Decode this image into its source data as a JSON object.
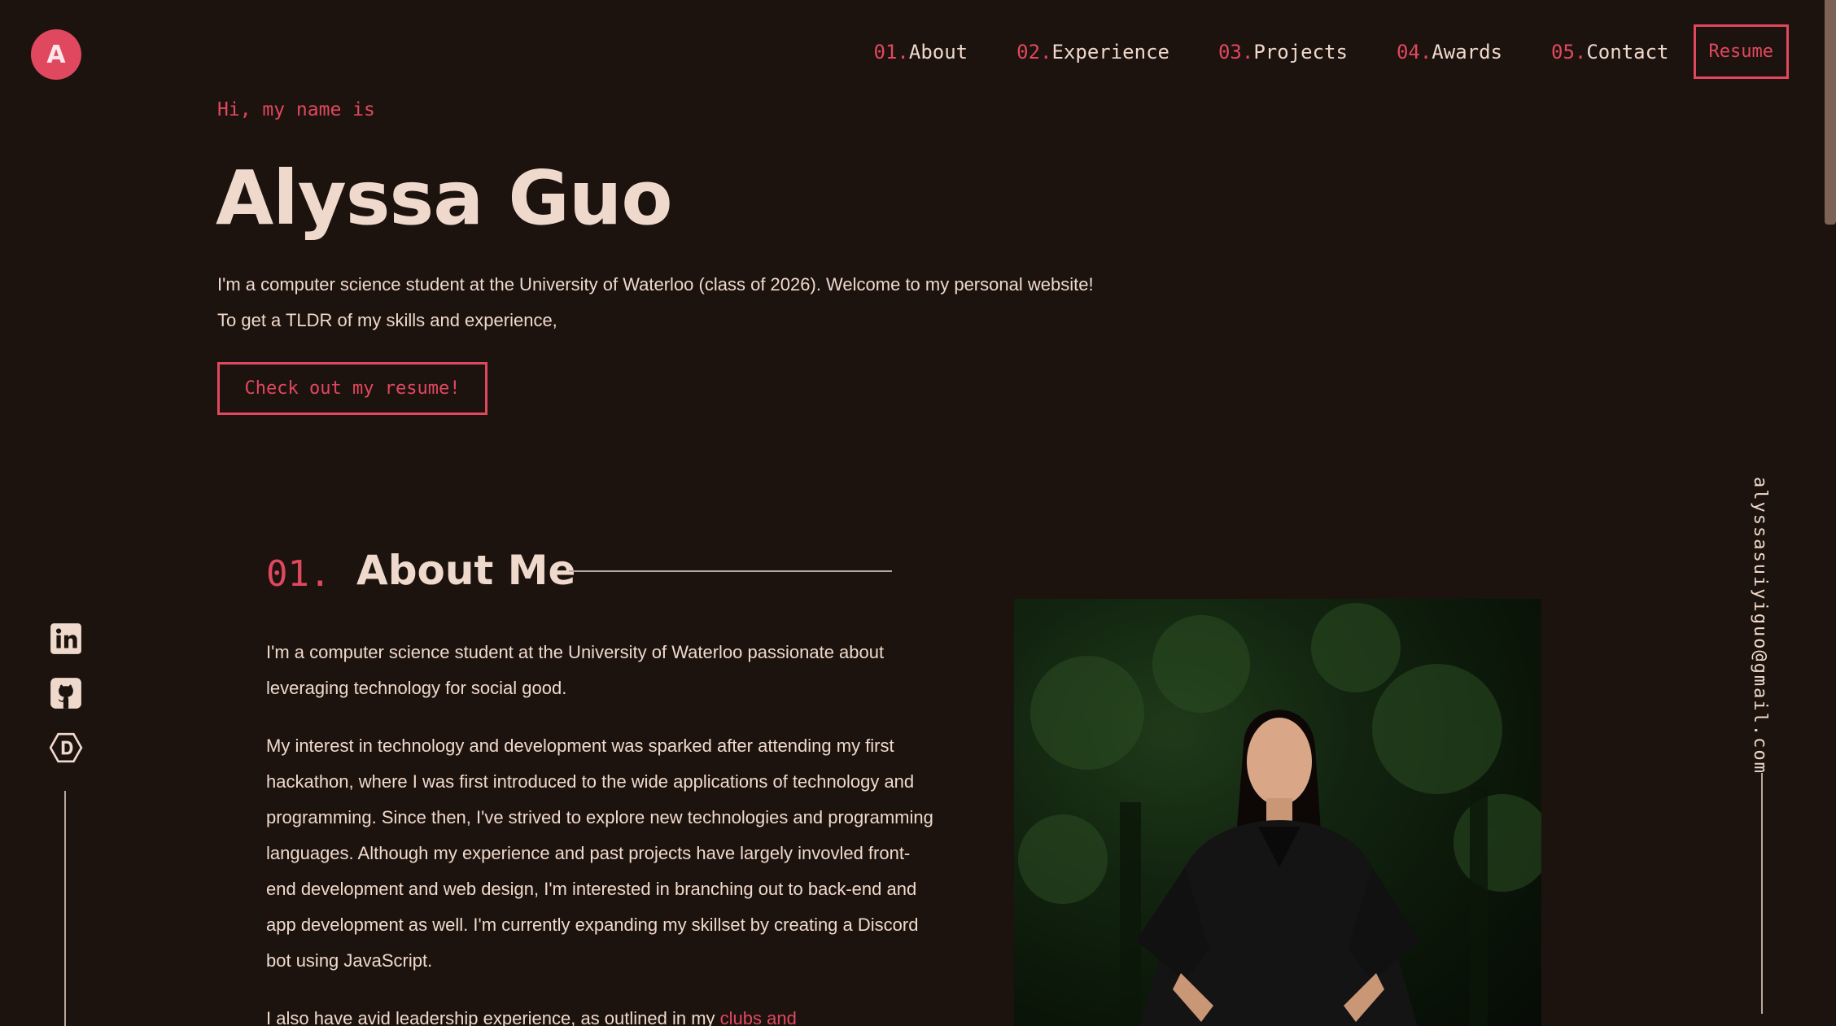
{
  "brand": {
    "logo_letter": "A"
  },
  "nav": {
    "items": [
      {
        "num": "01.",
        "label": "About"
      },
      {
        "num": "02.",
        "label": "Experience"
      },
      {
        "num": "03.",
        "label": "Projects"
      },
      {
        "num": "04.",
        "label": "Awards"
      },
      {
        "num": "05.",
        "label": "Contact"
      }
    ],
    "resume_label": "Resume"
  },
  "hero": {
    "intro": "Hi, my name is",
    "name": "Alyssa Guo",
    "line1": "I'm a computer science student at the University of Waterloo (class of 2026). Welcome to my personal website!",
    "line2": "To get a TLDR of my skills and experience,",
    "cta_label": "Check out my resume!"
  },
  "about": {
    "num": "01.",
    "title": "About Me",
    "p1": "I'm a computer science student at the University of Waterloo passionate about leveraging technology for social good.",
    "p2": "My interest in technology and development was sparked after attending my first hackathon, where I was first introduced to the wide applications of technology and programming. Since then, I've strived to explore new technologies and programming languages. Although my experience and past projects have largely invovled front-end development and web design, I'm interested in branching out to back-end and app development as well. I'm currently expanding my skillset by creating a Discord bot using JavaScript.",
    "p3_text": "I also have avid leadership experience, as outlined in my ",
    "p3_link": "clubs and"
  },
  "socials": [
    "linkedin-icon",
    "github-icon",
    "devpost-icon"
  ],
  "email": "alyssasuiyiguo@gmail.com",
  "colors": {
    "background": "#1d130e",
    "accent": "#e0485f",
    "text": "#efd9cc"
  }
}
